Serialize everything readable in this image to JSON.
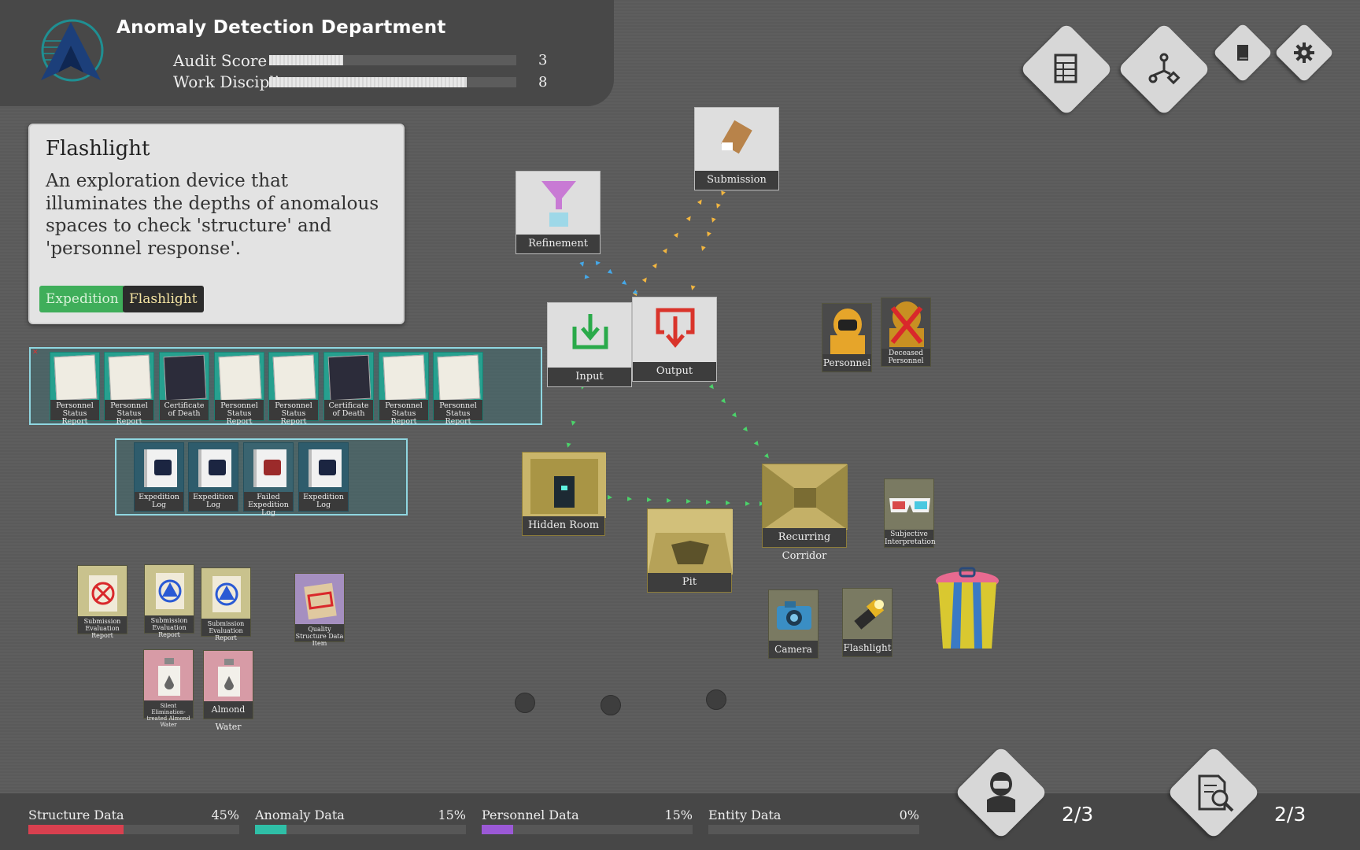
{
  "header": {
    "title": "Anomaly Detection Department",
    "stats": [
      {
        "label": "Audit Score",
        "value": "3",
        "fill": 0.3
      },
      {
        "label": "Work Discipline",
        "value": "8",
        "fill": 0.8
      }
    ]
  },
  "top_buttons": [
    {
      "icon": "document-grid-icon"
    },
    {
      "icon": "flow-graph-icon"
    },
    {
      "icon": "book-icon"
    },
    {
      "icon": "gear-icon"
    }
  ],
  "tooltip": {
    "title": "Flashlight",
    "description": "An exploration device that illuminates the depths of anomalous spaces to check 'structure' and 'personnel response'.",
    "tags": [
      "Expedition",
      "Flashlight"
    ],
    "tag_colors": {
      "expedition": "#3fae5a",
      "flashlight": "#2c2c2c"
    }
  },
  "report_stack": [
    "Personnel Status Report",
    "Personnel Status Report",
    "Certificate of Death",
    "Personnel Status Report",
    "Personnel Status Report",
    "Certificate of Death",
    "Personnel Status Report",
    "Personnel Status Report"
  ],
  "log_stack": [
    "Expedition Log",
    "Expedition Log",
    "Failed Expedition Log",
    "Expedition Log"
  ],
  "nodes": {
    "submission": "Submission",
    "refinement": "Refinement",
    "input": "Input",
    "output": "Output",
    "hidden_room": "Hidden Room",
    "recurring_corridor": "Recurring Corridor",
    "pit": "Pit"
  },
  "items": {
    "personnel": "Personnel",
    "deceased_personnel": "Deceased Personnel",
    "subjective_interpretation": "Subjective Interpretation",
    "camera": "Camera",
    "flashlight": "Flashlight",
    "sub_eval_1": "Submission Evaluation Report",
    "sub_eval_2": "Submission Evaluation Report",
    "sub_eval_3": "Submission Evaluation Report",
    "quality_structure": "Quality Structure Data Item",
    "silent_water": "Silent Elimination-treated Almond Water",
    "almond_water": "Almond Water"
  },
  "data_bars": [
    {
      "label": "Structure Data",
      "pct": "45%",
      "value": 0.45,
      "color": "#d9404f"
    },
    {
      "label": "Anomaly Data",
      "pct": "15%",
      "value": 0.15,
      "color": "#2fbfa7"
    },
    {
      "label": "Personnel Data",
      "pct": "15%",
      "value": 0.15,
      "color": "#9b59d6"
    },
    {
      "label": "Entity Data",
      "pct": "0%",
      "value": 0.0,
      "color": "#999999"
    }
  ],
  "counters": {
    "personnel_count": "2/3",
    "investigation_count": "2/3"
  },
  "colors": {
    "input_arrow": "#2aaa4a",
    "output_arrow": "#d9342b",
    "flow_green": "#4bd36a",
    "flow_orange": "#f2b640",
    "flow_blue": "#45a8e8"
  }
}
